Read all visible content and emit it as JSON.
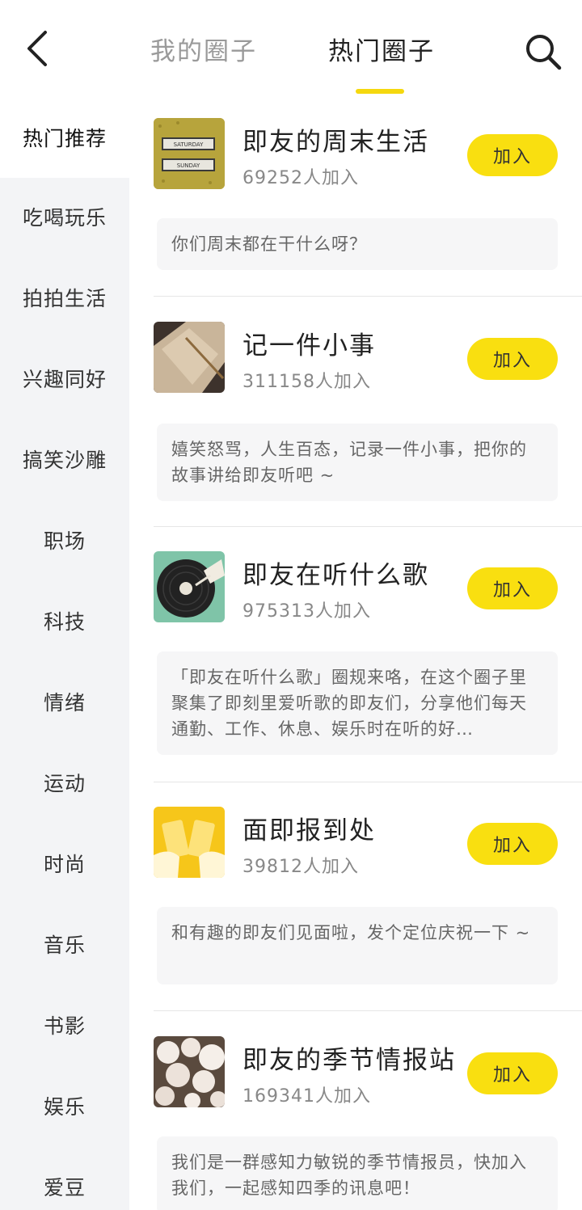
{
  "header": {
    "tabs": [
      {
        "label": "我的圈子"
      },
      {
        "label": "热门圈子"
      }
    ]
  },
  "sidebar": {
    "items": [
      {
        "label": "热门推荐"
      },
      {
        "label": "吃喝玩乐"
      },
      {
        "label": "拍拍生活"
      },
      {
        "label": "兴趣同好"
      },
      {
        "label": "搞笑沙雕"
      },
      {
        "label": "职场"
      },
      {
        "label": "科技"
      },
      {
        "label": "情绪"
      },
      {
        "label": "运动"
      },
      {
        "label": "时尚"
      },
      {
        "label": "音乐"
      },
      {
        "label": "书影"
      },
      {
        "label": "娱乐"
      },
      {
        "label": "爱豆"
      }
    ]
  },
  "circles": [
    {
      "title": "即友的周末生活",
      "count": "69252人加入",
      "join_label": "加入",
      "description": "你们周末都在干什么呀？",
      "thumb_text": [
        "SATURDAY",
        "SUNDAY"
      ]
    },
    {
      "title": "记一件小事",
      "count": "311158人加入",
      "join_label": "加入",
      "description": "嬉笑怒骂，人生百态，记录一件小事，把你的故事讲给即友听吧 ~"
    },
    {
      "title": "即友在听什么歌",
      "count": "975313人加入",
      "join_label": "加入",
      "description": "「即友在听什么歌」圈规来咯，在这个圈子里聚集了即刻里爱听歌的即友们，分享他们每天通勤、工作、休息、娱乐时在听的好…"
    },
    {
      "title": "面即报到处",
      "count": "39812人加入",
      "join_label": "加入",
      "description": "和有趣的即友们见面啦，发个定位庆祝一下 ~"
    },
    {
      "title": "即友的季节情报站",
      "count": "169341人加入",
      "join_label": "加入",
      "description": "我们是一群感知力敏锐的季节情报员，快加入我们，一起感知四季的讯息吧！"
    }
  ],
  "colors": {
    "accent": "#f9df10",
    "sidebar_bg": "#f3f4f6",
    "desc_bg": "#f6f6f7"
  }
}
